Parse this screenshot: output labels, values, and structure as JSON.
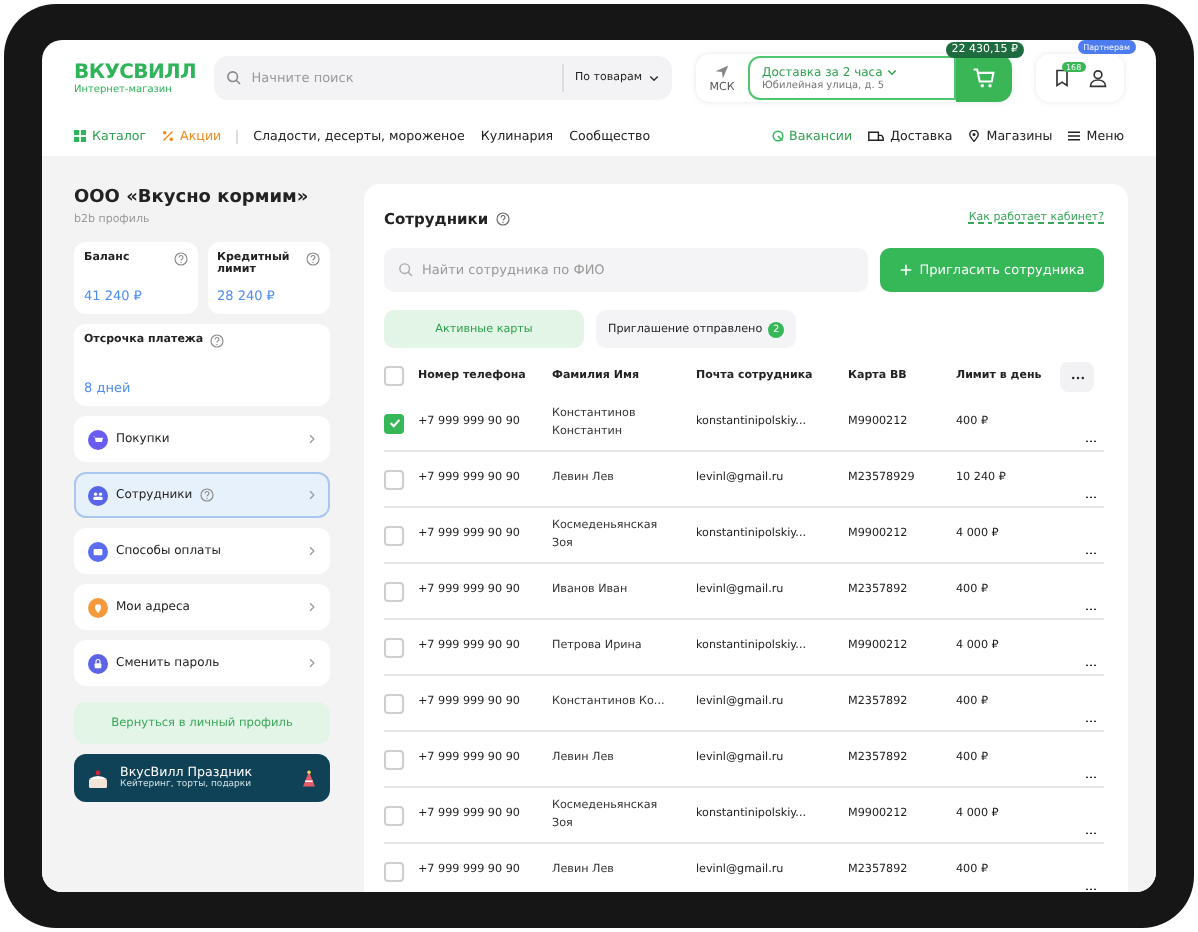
{
  "header": {
    "logo": {
      "title": "ВКУСВИЛЛ",
      "subtitle": "Интернет-магазин"
    },
    "search": {
      "placeholder": "Начните поиск",
      "scope": "По товарам"
    },
    "city": "МСК",
    "delivery": {
      "title": "Доставка за 2 часа",
      "address": "Юбилейная улица, д. 5"
    },
    "cart_total": "22 430,15 ₽",
    "messages_badge": "168",
    "partner_badge": "Партнерам"
  },
  "nav": {
    "left": [
      {
        "label": "Каталог",
        "kind": "catalog"
      },
      {
        "label": "Акции",
        "kind": "sale"
      },
      {
        "label": "Сладости, десерты, мороженое",
        "kind": "link"
      },
      {
        "label": "Кулинария",
        "kind": "link"
      },
      {
        "label": "Сообщество",
        "kind": "link"
      }
    ],
    "right": [
      {
        "label": "Вакансии",
        "kind": "jobs"
      },
      {
        "label": "Доставка",
        "kind": "truck"
      },
      {
        "label": "Магазины",
        "kind": "pin"
      },
      {
        "label": "Меню",
        "kind": "menu"
      }
    ]
  },
  "sidebar": {
    "company": "ООО «Вкусно кормим»",
    "profile": "b2b профиль",
    "stats": [
      {
        "label": "Баланс",
        "value": "41 240 ₽"
      },
      {
        "label": "Кредитный лимит",
        "value": "28 240 ₽"
      }
    ],
    "deferral": {
      "label": "Отсрочка платежа",
      "value": "8 дней"
    },
    "items": [
      {
        "label": "Покупки",
        "kind": "cart",
        "color": "#6a5cf0",
        "selected": false,
        "help": false
      },
      {
        "label": "Сотрудники",
        "kind": "people",
        "color": "#5865e8",
        "selected": true,
        "help": true
      },
      {
        "label": "Способы оплаты",
        "kind": "wallet",
        "color": "#5b6cf2",
        "selected": false,
        "help": false
      },
      {
        "label": "Мои адреса",
        "kind": "pin",
        "color": "#f59a3c",
        "selected": false,
        "help": false
      },
      {
        "label": "Сменить пароль",
        "kind": "lock",
        "color": "#5d63e6",
        "selected": false,
        "help": false
      }
    ],
    "back_button": "Вернуться в личный профиль",
    "banner": {
      "title": "ВкусВилл Праздник",
      "subtitle": "Кейтеринг, торты, подарки"
    }
  },
  "employees": {
    "title": "Сотрудники",
    "help_link": "Как работает кабинет?",
    "search": {
      "placeholder": "Найти сотрудника по ФИО"
    },
    "invite_button": "Пригласить сотрудника",
    "tabs": [
      {
        "label": "Активные карты",
        "selected": true
      },
      {
        "label": "Приглашение отправлено",
        "count": "2",
        "selected": false
      }
    ],
    "table": {
      "select_all": {
        "checked": false
      },
      "columns": [
        "Номер телефона",
        "Фамилия Имя",
        "Почта сотрудника",
        "Карта ВВ",
        "Лимит в день"
      ],
      "rows": [
        {
          "checked": true,
          "phone": "+7 999 999 90 90",
          "name": [
            "Константинов",
            "Константин"
          ],
          "email": "konstantinipolskiy...",
          "card": "M9900212",
          "limit": "400 ₽"
        },
        {
          "checked": false,
          "phone": "+7 999 999 90 90",
          "name": [
            "Левин Лев"
          ],
          "email": "levinl@gmail.ru",
          "card": "M23578929",
          "limit": "10 240 ₽"
        },
        {
          "checked": false,
          "phone": "+7 999 999 90 90",
          "name": [
            "Космеденьянская",
            "Зоя"
          ],
          "email": "konstantinipolskiy...",
          "card": "M9900212",
          "limit": "4 000 ₽"
        },
        {
          "checked": false,
          "phone": "+7 999 999 90 90",
          "name": [
            "Иванов Иван"
          ],
          "email": "levinl@gmail.ru",
          "card": "M2357892",
          "limit": "400 ₽"
        },
        {
          "checked": false,
          "phone": "+7 999 999 90 90",
          "name": [
            "Петрова Ирина"
          ],
          "email": "konstantinipolskiy...",
          "card": "M9900212",
          "limit": "4 000 ₽"
        },
        {
          "checked": false,
          "phone": "+7 999 999 90 90",
          "name": [
            "Константинов Ко..."
          ],
          "email": "levinl@gmail.ru",
          "card": "M2357892",
          "limit": "400 ₽"
        },
        {
          "checked": false,
          "phone": "+7 999 999 90 90",
          "name": [
            "Левин Лев"
          ],
          "email": "levinl@gmail.ru",
          "card": "M2357892",
          "limit": "400 ₽"
        },
        {
          "checked": false,
          "phone": "+7 999 999 90 90",
          "name": [
            "Космеденьянская",
            "Зоя"
          ],
          "email": "konstantinipolskiy...",
          "card": "M9900212",
          "limit": "4 000 ₽"
        },
        {
          "checked": false,
          "phone": "+7 999 999 90 90",
          "name": [
            "Левин Лев"
          ],
          "email": "levinl@gmail.ru",
          "card": "M2357892",
          "limit": "400 ₽"
        }
      ]
    }
  }
}
